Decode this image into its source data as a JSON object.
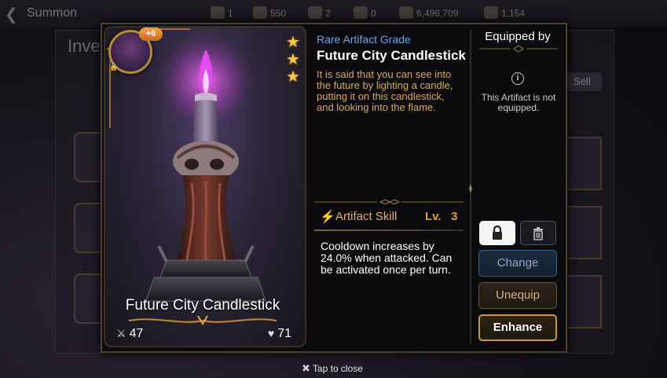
{
  "background": {
    "screen_title": "Summon",
    "inventory_title": "Inve",
    "sell_label": "Sell",
    "resources": [
      "1",
      "550",
      "2",
      "0",
      "6,496,709",
      "1,154"
    ]
  },
  "artifact": {
    "enhance_level": "+6",
    "star_count": 3,
    "grade": "Rare Artifact Grade",
    "name": "Future City Candlestick",
    "card_name": "Future City Candlestick",
    "description": "It is said that you can see into the future by lighting a candle, putting it on this candlestick, and looking into the flame.",
    "attack": "47",
    "health": "71",
    "skill": {
      "label": "Artifact Skill",
      "level_prefix": "Lv.",
      "level": "3",
      "description": "Cooldown increases by 24.0% when attacked. Can be activated once per turn."
    }
  },
  "equipped_panel": {
    "title": "Equipped by",
    "status": "This Artifact is not equipped."
  },
  "buttons": {
    "change": "Change",
    "unequip": "Unequip",
    "enhance": "Enhance"
  },
  "footer": {
    "tap_to_close": "Tap to close"
  },
  "colors": {
    "grade_blue": "#6fa3e8",
    "lore_gold": "#d9a864",
    "skill_gold": "#e3b064",
    "enhance_border": "#c9974a"
  }
}
